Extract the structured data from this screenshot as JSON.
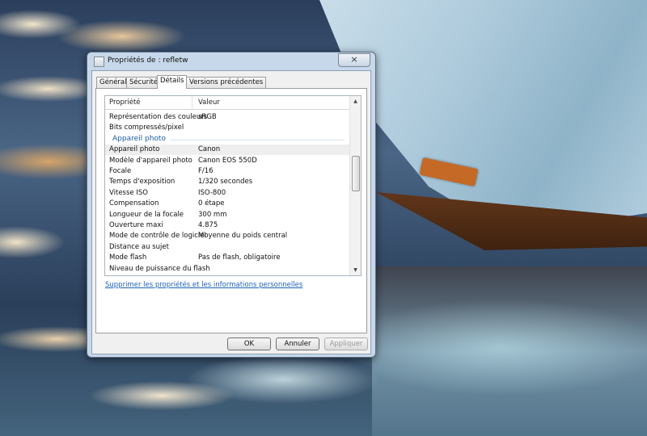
{
  "window": {
    "title": "Propriétés de : refletw",
    "close_symbol": "×"
  },
  "tabs": [
    {
      "label": "Général"
    },
    {
      "label": "Sécurité"
    },
    {
      "label": "Détails"
    },
    {
      "label": "Versions précédentes"
    }
  ],
  "active_tab": "Détails",
  "list": {
    "columns": {
      "property": "Propriété",
      "value": "Valeur"
    },
    "rows": [
      {
        "property": "Représentation des couleurs",
        "value": "sRGB"
      },
      {
        "property": "Bits compressés/pixel",
        "value": ""
      },
      {
        "group": "Appareil photo"
      },
      {
        "property": "Appareil photo",
        "value": "Canon",
        "selected": true
      },
      {
        "property": "Modèle d'appareil photo",
        "value": "Canon EOS 550D"
      },
      {
        "property": "Focale",
        "value": "F/16"
      },
      {
        "property": "Temps d'exposition",
        "value": "1/320 secondes"
      },
      {
        "property": "Vitesse ISO",
        "value": "ISO-800"
      },
      {
        "property": "Compensation",
        "value": "0 étape"
      },
      {
        "property": "Longueur de la focale",
        "value": "300 mm"
      },
      {
        "property": "Ouverture maxi",
        "value": "4.875"
      },
      {
        "property": "Mode de contrôle de logiciel",
        "value": "Moyenne du poids central"
      },
      {
        "property": "Distance au sujet",
        "value": ""
      },
      {
        "property": "Mode flash",
        "value": "Pas de flash, obligatoire"
      },
      {
        "property": "Niveau de puissance du flash",
        "value": ""
      }
    ]
  },
  "remove_link": "Supprimer les propriétés et les informations personnelles",
  "buttons": {
    "ok": "OK",
    "cancel": "Annuler",
    "apply": "Appliquer"
  },
  "scrollbar": {
    "up_arrow": "▲",
    "down_arrow": "▼"
  }
}
